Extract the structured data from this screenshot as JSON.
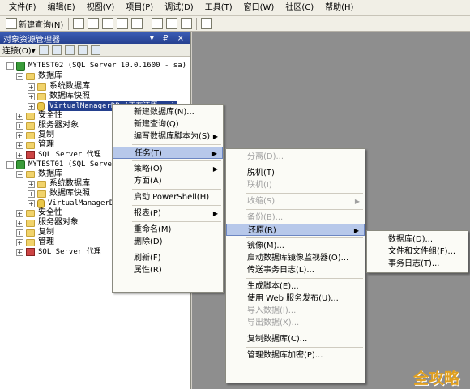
{
  "menubar": [
    "文件(F)",
    "编辑(E)",
    "视图(V)",
    "项目(P)",
    "调试(D)",
    "工具(T)",
    "窗口(W)",
    "社区(C)",
    "帮助(H)"
  ],
  "toolbar": {
    "new_query": "新建查询(N)"
  },
  "object_explorer": {
    "title": "对象资源管理器",
    "title_controls": "▾ ₽ ×",
    "connect": "连接(O)▾",
    "tree": [
      {
        "text": "MYTEST02 (SQL Server 10.0.1600 - sa)",
        "type": "server",
        "expand": "−"
      },
      {
        "text": "数据库",
        "type": "folder",
        "expand": "−"
      },
      {
        "text": "系统数据库",
        "type": "folder",
        "expand": "+"
      },
      {
        "text": "数据库快照",
        "type": "folder",
        "expand": "+"
      },
      {
        "text": "VirtualManagerDB (正在还原...)",
        "type": "db",
        "expand": "+",
        "selected": true
      },
      {
        "text": "安全性",
        "type": "folder",
        "expand": "+"
      },
      {
        "text": "服务器对象",
        "type": "folder",
        "expand": "+"
      },
      {
        "text": "复制",
        "type": "folder",
        "expand": "+"
      },
      {
        "text": "管理",
        "type": "folder",
        "expand": "+"
      },
      {
        "text": "SQL Server 代理",
        "type": "agent",
        "expand": "+"
      },
      {
        "text": "MYTEST01 (SQL Server 10",
        "type": "server",
        "expand": "−"
      },
      {
        "text": "数据库",
        "type": "folder",
        "expand": "−"
      },
      {
        "text": "系统数据库",
        "type": "folder",
        "expand": "+"
      },
      {
        "text": "数据库快照",
        "type": "folder",
        "expand": "+"
      },
      {
        "text": "VirtualManagerDB",
        "type": "db",
        "expand": "+"
      },
      {
        "text": "安全性",
        "type": "folder",
        "expand": "+"
      },
      {
        "text": "服务器对象",
        "type": "folder",
        "expand": "+"
      },
      {
        "text": "复制",
        "type": "folder",
        "expand": "+"
      },
      {
        "text": "管理",
        "type": "folder",
        "expand": "+"
      },
      {
        "text": "SQL Server 代理",
        "type": "agent",
        "expand": "+"
      }
    ]
  },
  "context_menu": [
    {
      "label": "新建数据库(N)..."
    },
    {
      "label": "新建查询(Q)"
    },
    {
      "label": "编写数据库脚本为(S)",
      "arrow": true
    },
    {
      "sep": true
    },
    {
      "label": "任务(T)",
      "arrow": true,
      "highlight": true
    },
    {
      "sep": true
    },
    {
      "label": "策略(O)",
      "arrow": true
    },
    {
      "label": "方面(A)"
    },
    {
      "sep": true
    },
    {
      "label": "启动 PowerShell(H)"
    },
    {
      "sep": true
    },
    {
      "label": "报表(P)",
      "arrow": true
    },
    {
      "sep": true
    },
    {
      "label": "重命名(M)"
    },
    {
      "label": "删除(D)"
    },
    {
      "sep": true
    },
    {
      "label": "刷新(F)"
    },
    {
      "label": "属性(R)"
    }
  ],
  "tasks_menu": [
    {
      "label": "分离(D)...",
      "disabled": true
    },
    {
      "sep": true
    },
    {
      "label": "脱机(T)"
    },
    {
      "label": "联机(I)",
      "disabled": true
    },
    {
      "sep": true
    },
    {
      "label": "收缩(S)",
      "arrow": true,
      "disabled": true
    },
    {
      "sep": true
    },
    {
      "label": "备份(B)...",
      "disabled": true
    },
    {
      "label": "还原(R)",
      "arrow": true,
      "highlight": true
    },
    {
      "sep": true
    },
    {
      "label": "镜像(M)..."
    },
    {
      "label": "启动数据库镜像监视器(O)..."
    },
    {
      "label": "传送事务日志(L)..."
    },
    {
      "sep": true
    },
    {
      "label": "生成脚本(E)..."
    },
    {
      "label": "使用 Web 服务发布(U)..."
    },
    {
      "label": "导入数据(I)...",
      "disabled": true
    },
    {
      "label": "导出数据(X)...",
      "disabled": true
    },
    {
      "sep": true
    },
    {
      "label": "复制数据库(C)..."
    },
    {
      "sep": true
    },
    {
      "label": "管理数据库加密(P)..."
    }
  ],
  "restore_menu": [
    {
      "label": "数据库(D)..."
    },
    {
      "label": "文件和文件组(F)..."
    },
    {
      "label": "事务日志(T)..."
    }
  ],
  "watermark": "全攻略"
}
